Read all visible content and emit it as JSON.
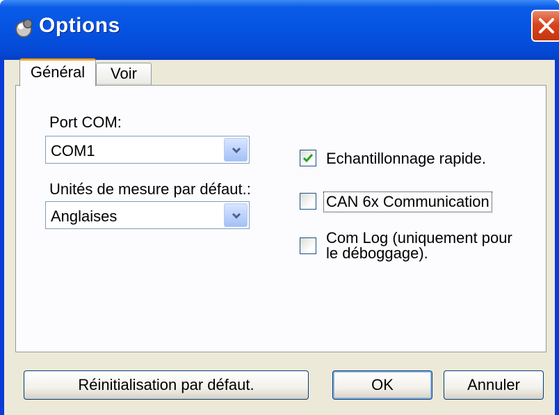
{
  "window": {
    "title": "Options"
  },
  "tabs": [
    {
      "label": "Général",
      "active": true
    },
    {
      "label": "Voir",
      "active": false
    }
  ],
  "general": {
    "port_label": "Port COM:",
    "port_value": "COM1",
    "units_label": "Unités de mesure par défaut.:",
    "units_value": "Anglaises",
    "options": [
      {
        "label": "Echantillonnage rapide.",
        "checked": true
      },
      {
        "label": "CAN 6x Communication",
        "checked": false
      },
      {
        "label": "Com Log (uniquement pour",
        "label2": "le déboggage).",
        "checked": false
      }
    ]
  },
  "buttons": {
    "reset": "Réinitialisation par défaut.",
    "ok": "OK",
    "cancel": "Annuler"
  },
  "icons": {
    "app": "options-app-icon",
    "close": "close-icon",
    "dropdown": "chevron-down-icon",
    "check": "checkmark-icon"
  },
  "colors": {
    "title_bar": "#0553e0",
    "close_button": "#d9451c",
    "dialog_face": "#ece9d8",
    "tab_highlight": "#f7a41c",
    "check_green": "#21a121"
  }
}
